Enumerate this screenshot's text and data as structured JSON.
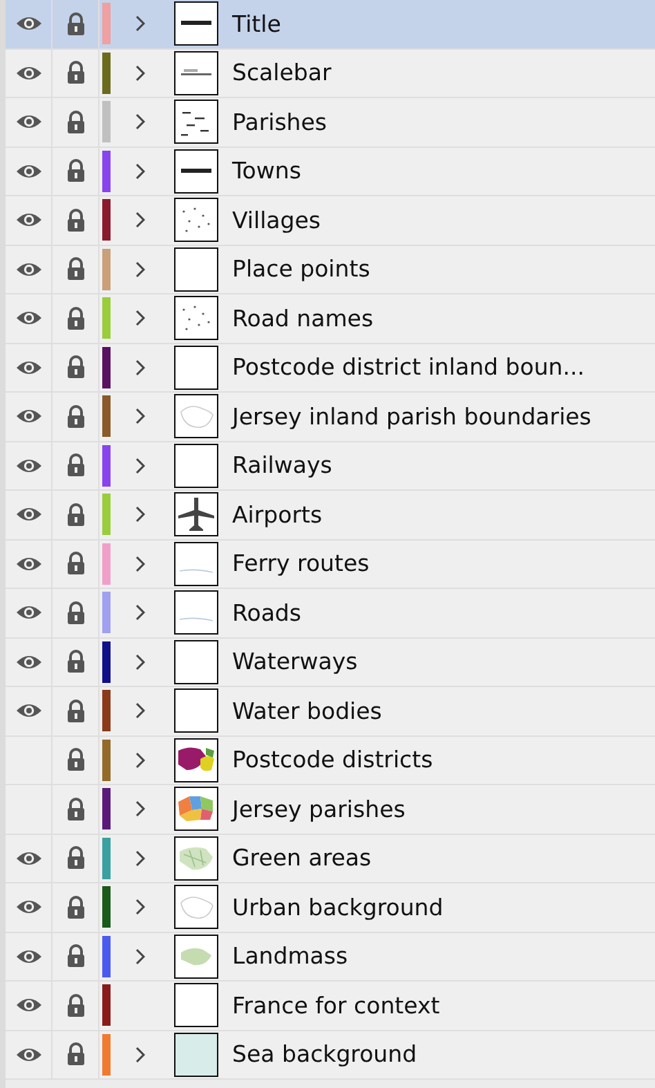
{
  "layers": [
    {
      "name": "Title",
      "visible": true,
      "locked": true,
      "expandable": true,
      "selected": true,
      "color": "#f0a0a0",
      "kind": "caption"
    },
    {
      "name": "Scalebar",
      "visible": true,
      "locked": true,
      "expandable": true,
      "selected": false,
      "color": "#6b6b1e",
      "kind": "line"
    },
    {
      "name": "Parishes",
      "visible": true,
      "locked": true,
      "expandable": true,
      "selected": false,
      "color": "#c0c0c0",
      "kind": "dashes"
    },
    {
      "name": "Towns",
      "visible": true,
      "locked": true,
      "expandable": true,
      "selected": false,
      "color": "#8844ee",
      "kind": "caption"
    },
    {
      "name": "Villages",
      "visible": true,
      "locked": true,
      "expandable": true,
      "selected": false,
      "color": "#8b1a2e",
      "kind": "dots"
    },
    {
      "name": "Place points",
      "visible": true,
      "locked": true,
      "expandable": true,
      "selected": false,
      "color": "#c9a07a",
      "kind": "blank"
    },
    {
      "name": "Road names",
      "visible": true,
      "locked": true,
      "expandable": true,
      "selected": false,
      "color": "#9acd3c",
      "kind": "dots"
    },
    {
      "name": "Postcode district inland boun...",
      "visible": true,
      "locked": true,
      "expandable": true,
      "selected": false,
      "color": "#5a1060",
      "kind": "blank"
    },
    {
      "name": "Jersey inland parish boundaries",
      "visible": true,
      "locked": true,
      "expandable": true,
      "selected": false,
      "color": "#8a5a2a",
      "kind": "outline"
    },
    {
      "name": "Railways",
      "visible": true,
      "locked": true,
      "expandable": true,
      "selected": false,
      "color": "#8844ee",
      "kind": "blank"
    },
    {
      "name": "Airports",
      "visible": true,
      "locked": true,
      "expandable": true,
      "selected": false,
      "color": "#9acd3c",
      "kind": "plane"
    },
    {
      "name": "Ferry routes",
      "visible": true,
      "locked": true,
      "expandable": true,
      "selected": false,
      "color": "#f0a0c8",
      "kind": "faint"
    },
    {
      "name": "Roads",
      "visible": true,
      "locked": true,
      "expandable": true,
      "selected": false,
      "color": "#a0a0f0",
      "kind": "faint"
    },
    {
      "name": "Waterways",
      "visible": true,
      "locked": true,
      "expandable": true,
      "selected": false,
      "color": "#10108a",
      "kind": "blank"
    },
    {
      "name": "Water bodies",
      "visible": true,
      "locked": true,
      "expandable": true,
      "selected": false,
      "color": "#8b3a1a",
      "kind": "blank"
    },
    {
      "name": "Postcode districts",
      "visible": false,
      "locked": true,
      "expandable": true,
      "selected": false,
      "color": "#946a2a",
      "kind": "districts"
    },
    {
      "name": "Jersey parishes",
      "visible": false,
      "locked": true,
      "expandable": true,
      "selected": false,
      "color": "#5a1a7a",
      "kind": "parishes"
    },
    {
      "name": "Green areas",
      "visible": true,
      "locked": true,
      "expandable": true,
      "selected": false,
      "color": "#3aa0a0",
      "kind": "green"
    },
    {
      "name": "Urban background",
      "visible": true,
      "locked": true,
      "expandable": true,
      "selected": false,
      "color": "#1a5a1a",
      "kind": "outline"
    },
    {
      "name": "Landmass",
      "visible": true,
      "locked": true,
      "expandable": true,
      "selected": false,
      "color": "#4a5af0",
      "kind": "land"
    },
    {
      "name": "France for context",
      "visible": true,
      "locked": true,
      "expandable": false,
      "selected": false,
      "color": "#8b1a1a",
      "kind": "blank"
    },
    {
      "name": "Sea background",
      "visible": true,
      "locked": true,
      "expandable": true,
      "selected": false,
      "color": "#f07a30",
      "kind": "sea"
    }
  ]
}
